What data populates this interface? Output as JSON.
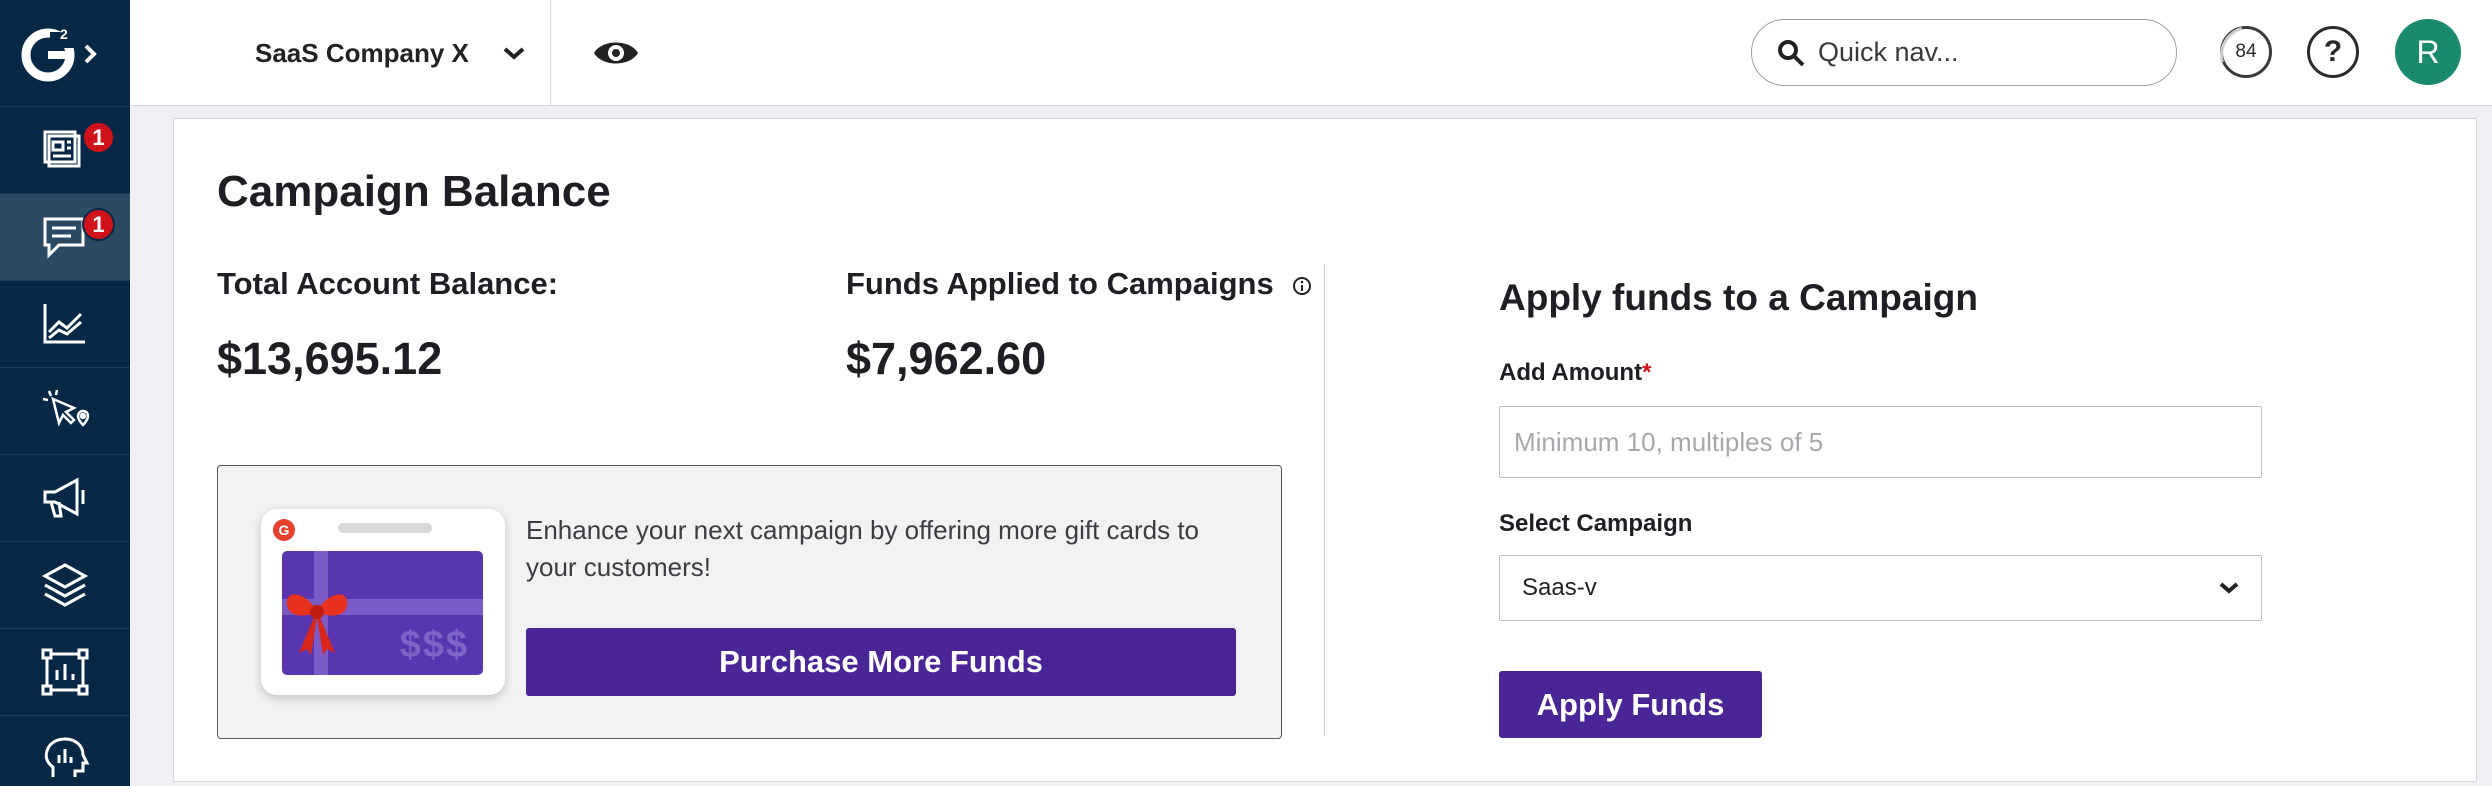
{
  "topbar": {
    "company_name": "SaaS Company X",
    "search_placeholder": "Quick nav...",
    "score": "84",
    "help_glyph": "?",
    "avatar_initial": "R"
  },
  "sidebar": {
    "logo": "g2-logo",
    "items": [
      {
        "icon": "dashboard-icon",
        "badge": "1"
      },
      {
        "icon": "chat-icon",
        "badge": "1",
        "active": true
      },
      {
        "icon": "analytics-icon"
      },
      {
        "icon": "cursor-click-icon"
      },
      {
        "icon": "megaphone-icon"
      },
      {
        "icon": "layers-icon"
      },
      {
        "icon": "chart-frame-icon"
      },
      {
        "icon": "head-icon"
      }
    ]
  },
  "main": {
    "title": "Campaign Balance",
    "total_balance_label": "Total Account Balance:",
    "total_balance_value": "$13,695.12",
    "funds_applied_label": "Funds Applied to Campaigns",
    "funds_applied_value": "$7,962.60",
    "promo": {
      "text": "Enhance your next campaign by offering more gift cards to your customers!",
      "button_label": "Purchase More Funds",
      "card_currency": "$$$"
    },
    "apply": {
      "title": "Apply funds to a Campaign",
      "amount_label": "Add Amount",
      "amount_required_mark": "*",
      "amount_placeholder": "Minimum 10, multiples of 5",
      "campaign_label": "Select Campaign",
      "campaign_selected": "Saas-v",
      "button_label": "Apply Funds"
    }
  },
  "colors": {
    "sidebar_bg": "#062846",
    "accent_purple": "#4a2596",
    "badge_red": "#d0121b",
    "avatar_green": "#1a8a6e"
  }
}
